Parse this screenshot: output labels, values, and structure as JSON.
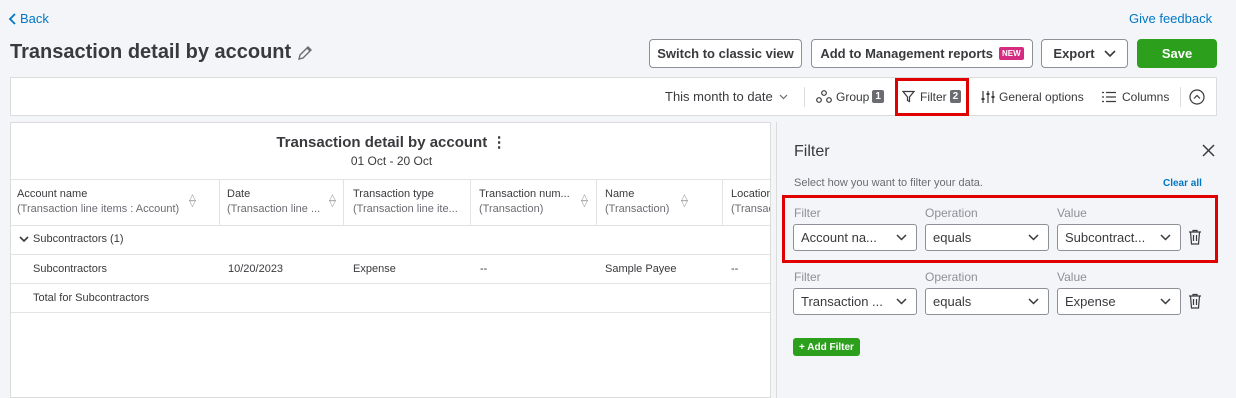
{
  "header": {
    "back_label": "Back",
    "feedback_label": "Give feedback",
    "page_title": "Transaction detail by account"
  },
  "actions": {
    "classic_view": "Switch to classic view",
    "add_mgmt": "Add to Management reports",
    "new_badge": "NEW",
    "export": "Export",
    "save": "Save"
  },
  "toolbar": {
    "date_range": "This month to date",
    "group_label": "Group",
    "group_count": "1",
    "filter_label": "Filter",
    "filter_count": "2",
    "general_options": "General options",
    "columns": "Columns"
  },
  "report": {
    "title": "Transaction detail by account",
    "date_range": "01 Oct - 20 Oct",
    "columns": [
      {
        "line1": "Account name",
        "line2": "(Transaction line items : Account)"
      },
      {
        "line1": "Date",
        "line2": "(Transaction line ..."
      },
      {
        "line1": "Transaction type",
        "line2": "(Transaction line ite..."
      },
      {
        "line1": "Transaction num...",
        "line2": "(Transaction)"
      },
      {
        "line1": "Name",
        "line2": "(Transaction)"
      },
      {
        "line1": "Location",
        "line2": "(Transac"
      }
    ],
    "group_label": "Subcontractors (1)",
    "row": {
      "account": "Subcontractors",
      "date": "10/20/2023",
      "type": "Expense",
      "num": "--",
      "name": "Sample Payee",
      "location": "--"
    },
    "total_label": "Total for Subcontractors"
  },
  "filter_panel": {
    "title": "Filter",
    "subtitle": "Select how you want to filter your data.",
    "clear_all": "Clear all",
    "labels": {
      "filter": "Filter",
      "operation": "Operation",
      "value": "Value"
    },
    "rows": [
      {
        "filter": "Account na...",
        "operation": "equals",
        "value": "Subcontract..."
      },
      {
        "filter": "Transaction ...",
        "operation": "equals",
        "value": "Expense"
      }
    ],
    "add_filter": "+ Add Filter"
  },
  "colors": {
    "accent_green": "#2ca01c",
    "link_blue": "#0077c5",
    "highlight_red": "#e00000",
    "new_badge": "#d52b80"
  }
}
